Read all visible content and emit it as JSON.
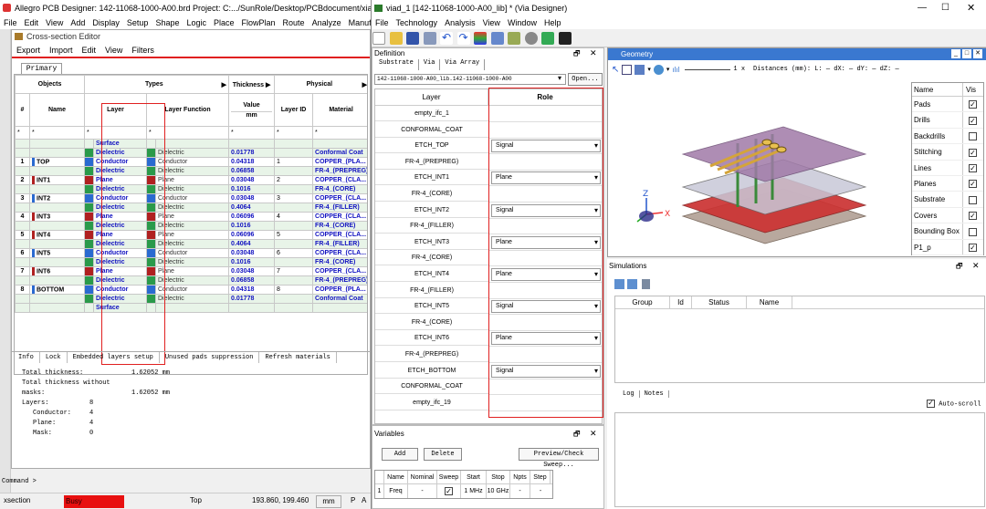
{
  "left_app": {
    "title": "Allegro PCB Designer: 142-11068-1000-A00.brd  Project: C:.../SunRole/Desktop/PCBdocument/xianka",
    "menu": [
      "File",
      "Edit",
      "View",
      "Add",
      "Display",
      "Setup",
      "Shape",
      "Logic",
      "Place",
      "FlowPlan",
      "Route",
      "Analyze",
      "Manufacture",
      "T"
    ],
    "cs_title": "Cross-section Editor",
    "cs_menu": [
      "Export",
      "Import",
      "Edit",
      "View",
      "Filters"
    ],
    "tab": "Primary",
    "headers": {
      "objects": "Objects",
      "types": "Types",
      "thickness": "Thickness",
      "physical": "Physical",
      "num": "#",
      "name": "Name",
      "layer": "Layer",
      "layer_function": "Layer Function",
      "value": "Value",
      "mm": "mm",
      "layer_id": "Layer ID",
      "material": "Material",
      "star": "*"
    },
    "rows": [
      {
        "num": "",
        "name": "",
        "layer": "Surface",
        "func": "",
        "thick": "",
        "id": "",
        "mat": "",
        "kind": "surface"
      },
      {
        "num": "",
        "name": "",
        "layer": "Dielectric",
        "func": "Dielectric",
        "thick": "0.01778",
        "id": "",
        "mat": "Conformal Coat",
        "kind": "d"
      },
      {
        "num": "1",
        "name": "TOP",
        "layer": "Conductor",
        "func": "Conductor",
        "thick": "0.04318",
        "id": "1",
        "mat": "COPPER_(PLA...",
        "kind": "c"
      },
      {
        "num": "",
        "name": "",
        "layer": "Dielectric",
        "func": "Dielectric",
        "thick": "0.06858",
        "id": "",
        "mat": "FR-4_(PREPREG)",
        "kind": "d"
      },
      {
        "num": "2",
        "name": "INT1",
        "layer": "Plane",
        "func": "Plane",
        "thick": "0.03048",
        "id": "2",
        "mat": "COPPER_(CLA...",
        "kind": "p"
      },
      {
        "num": "",
        "name": "",
        "layer": "Dielectric",
        "func": "Dielectric",
        "thick": "0.1016",
        "id": "",
        "mat": "FR-4_(CORE)",
        "kind": "d"
      },
      {
        "num": "3",
        "name": "INT2",
        "layer": "Conductor",
        "func": "Conductor",
        "thick": "0.03048",
        "id": "3",
        "mat": "COPPER_(CLA...",
        "kind": "c"
      },
      {
        "num": "",
        "name": "",
        "layer": "Dielectric",
        "func": "Dielectric",
        "thick": "0.4064",
        "id": "",
        "mat": "FR-4_(FILLER)",
        "kind": "d"
      },
      {
        "num": "4",
        "name": "INT3",
        "layer": "Plane",
        "func": "Plane",
        "thick": "0.06096",
        "id": "4",
        "mat": "COPPER_(CLA...",
        "kind": "p"
      },
      {
        "num": "",
        "name": "",
        "layer": "Dielectric",
        "func": "Dielectric",
        "thick": "0.1016",
        "id": "",
        "mat": "FR-4_(CORE)",
        "kind": "d"
      },
      {
        "num": "5",
        "name": "INT4",
        "layer": "Plane",
        "func": "Plane",
        "thick": "0.06096",
        "id": "5",
        "mat": "COPPER_(CLA...",
        "kind": "p"
      },
      {
        "num": "",
        "name": "",
        "layer": "Dielectric",
        "func": "Dielectric",
        "thick": "0.4064",
        "id": "",
        "mat": "FR-4_(FILLER)",
        "kind": "d"
      },
      {
        "num": "6",
        "name": "INT5",
        "layer": "Conductor",
        "func": "Conductor",
        "thick": "0.03048",
        "id": "6",
        "mat": "COPPER_(CLA...",
        "kind": "c"
      },
      {
        "num": "",
        "name": "",
        "layer": "Dielectric",
        "func": "Dielectric",
        "thick": "0.1016",
        "id": "",
        "mat": "FR-4_(CORE)",
        "kind": "d"
      },
      {
        "num": "7",
        "name": "INT6",
        "layer": "Plane",
        "func": "Plane",
        "thick": "0.03048",
        "id": "7",
        "mat": "COPPER_(CLA...",
        "kind": "p"
      },
      {
        "num": "",
        "name": "",
        "layer": "Dielectric",
        "func": "Dielectric",
        "thick": "0.06858",
        "id": "",
        "mat": "FR-4_(PREPREG)",
        "kind": "d"
      },
      {
        "num": "8",
        "name": "BOTTOM",
        "layer": "Conductor",
        "func": "Conductor",
        "thick": "0.04318",
        "id": "8",
        "mat": "COPPER_(PLA...",
        "kind": "c"
      },
      {
        "num": "",
        "name": "",
        "layer": "Dielectric",
        "func": "Dielectric",
        "thick": "0.01778",
        "id": "",
        "mat": "Conformal Coat",
        "kind": "d"
      },
      {
        "num": "",
        "name": "",
        "layer": "Surface",
        "func": "",
        "thick": "",
        "id": "",
        "mat": "",
        "kind": "surface"
      }
    ],
    "info_tabs": [
      "Info",
      "Lock",
      "Embedded layers setup",
      "Unused pads suppression",
      "Refresh materials"
    ],
    "info": {
      "total_thickness_label": "Total thickness:",
      "total_thickness": "1.62052 mm",
      "total_no_mask_label": "Total thickness without masks:",
      "total_no_mask": "1.62052 mm",
      "layers_label": "Layers:",
      "layers": "8",
      "conductor_label": "Conductor:",
      "conductor": "4",
      "plane_label": "Plane:",
      "plane": "4",
      "mask_label": "Mask:",
      "mask": "0"
    },
    "status": {
      "left": "xsection",
      "busy": "Busy",
      "layer": "Top",
      "coords": "193.860, 199.460",
      "unit": "mm",
      "p": "P",
      "a": "A"
    },
    "command": "Command >"
  },
  "right_app": {
    "title": "viad_1 [142-11068-1000-A00_lib] * (Via Designer)",
    "menu": [
      "File",
      "Technology",
      "Analysis",
      "View",
      "Window",
      "Help"
    ],
    "definition": {
      "title": "Definition",
      "tabs": [
        "Substrate",
        "Via",
        "Via Array"
      ],
      "dropdown": "142-11068-1000-A00_lib.142-11068-1000-A00",
      "open_btn": "Open...",
      "col_layer": "Layer",
      "col_role": "Role",
      "layers": [
        {
          "name": "empty_ifc_1",
          "role": ""
        },
        {
          "name": "CONFORMAL_COAT",
          "role": ""
        },
        {
          "name": "ETCH_TOP",
          "role": "Signal"
        },
        {
          "name": "FR-4_(PREPREG)",
          "role": ""
        },
        {
          "name": "ETCH_INT1",
          "role": "Plane"
        },
        {
          "name": "FR-4_(CORE)",
          "role": ""
        },
        {
          "name": "ETCH_INT2",
          "role": "Signal"
        },
        {
          "name": "FR-4_(FILLER)",
          "role": ""
        },
        {
          "name": "ETCH_INT3",
          "role": "Plane"
        },
        {
          "name": "FR-4_(CORE)",
          "role": ""
        },
        {
          "name": "ETCH_INT4",
          "role": "Plane"
        },
        {
          "name": "FR-4_(FILLER)",
          "role": ""
        },
        {
          "name": "ETCH_INT5",
          "role": "Signal"
        },
        {
          "name": "FR-4_(CORE)",
          "role": ""
        },
        {
          "name": "ETCH_INT6",
          "role": "Plane"
        },
        {
          "name": "FR-4_(PREPREG)",
          "role": ""
        },
        {
          "name": "ETCH_BOTTOM",
          "role": "Signal"
        },
        {
          "name": "CONFORMAL_COAT",
          "role": ""
        },
        {
          "name": "empty_ifc_19",
          "role": ""
        }
      ]
    },
    "geometry": {
      "title": "Geometry",
      "zoom": "1 x",
      "distances": "Distances (mm): L: — dX: — dY: — dZ: —",
      "vis_header_name": "Name",
      "vis_header_vis": "Vis",
      "items": [
        {
          "name": "Pads",
          "checked": true
        },
        {
          "name": "Drills",
          "checked": true
        },
        {
          "name": "Backdrills",
          "checked": false
        },
        {
          "name": "Stitching",
          "checked": true
        },
        {
          "name": "Lines",
          "checked": true
        },
        {
          "name": "Planes",
          "checked": true
        },
        {
          "name": "Substrate",
          "checked": false
        },
        {
          "name": "Covers",
          "checked": true
        },
        {
          "name": "Bounding Box",
          "checked": false
        },
        {
          "name": "P1_p",
          "checked": true
        }
      ],
      "axis_x": "X",
      "axis_z": "Z"
    },
    "simulations": {
      "title": "Simulations",
      "cols": [
        "Group",
        "Id",
        "Status",
        "Name"
      ]
    },
    "log": {
      "tabs": [
        "Log",
        "Notes"
      ],
      "autoscroll": "Auto-scroll"
    },
    "variables": {
      "title": "Variables",
      "add": "Add",
      "delete": "Delete",
      "sweep_btn": "Preview/Check Sweep...",
      "cols": [
        "Name",
        "Nominal",
        "Sweep",
        "Start",
        "Stop",
        "Npts",
        "Step"
      ],
      "row": {
        "idx": "1",
        "name": "Freq",
        "nominal": "-",
        "start": "1 MHz",
        "stop": "10 GHz",
        "npts": "-",
        "step": "-"
      }
    }
  }
}
